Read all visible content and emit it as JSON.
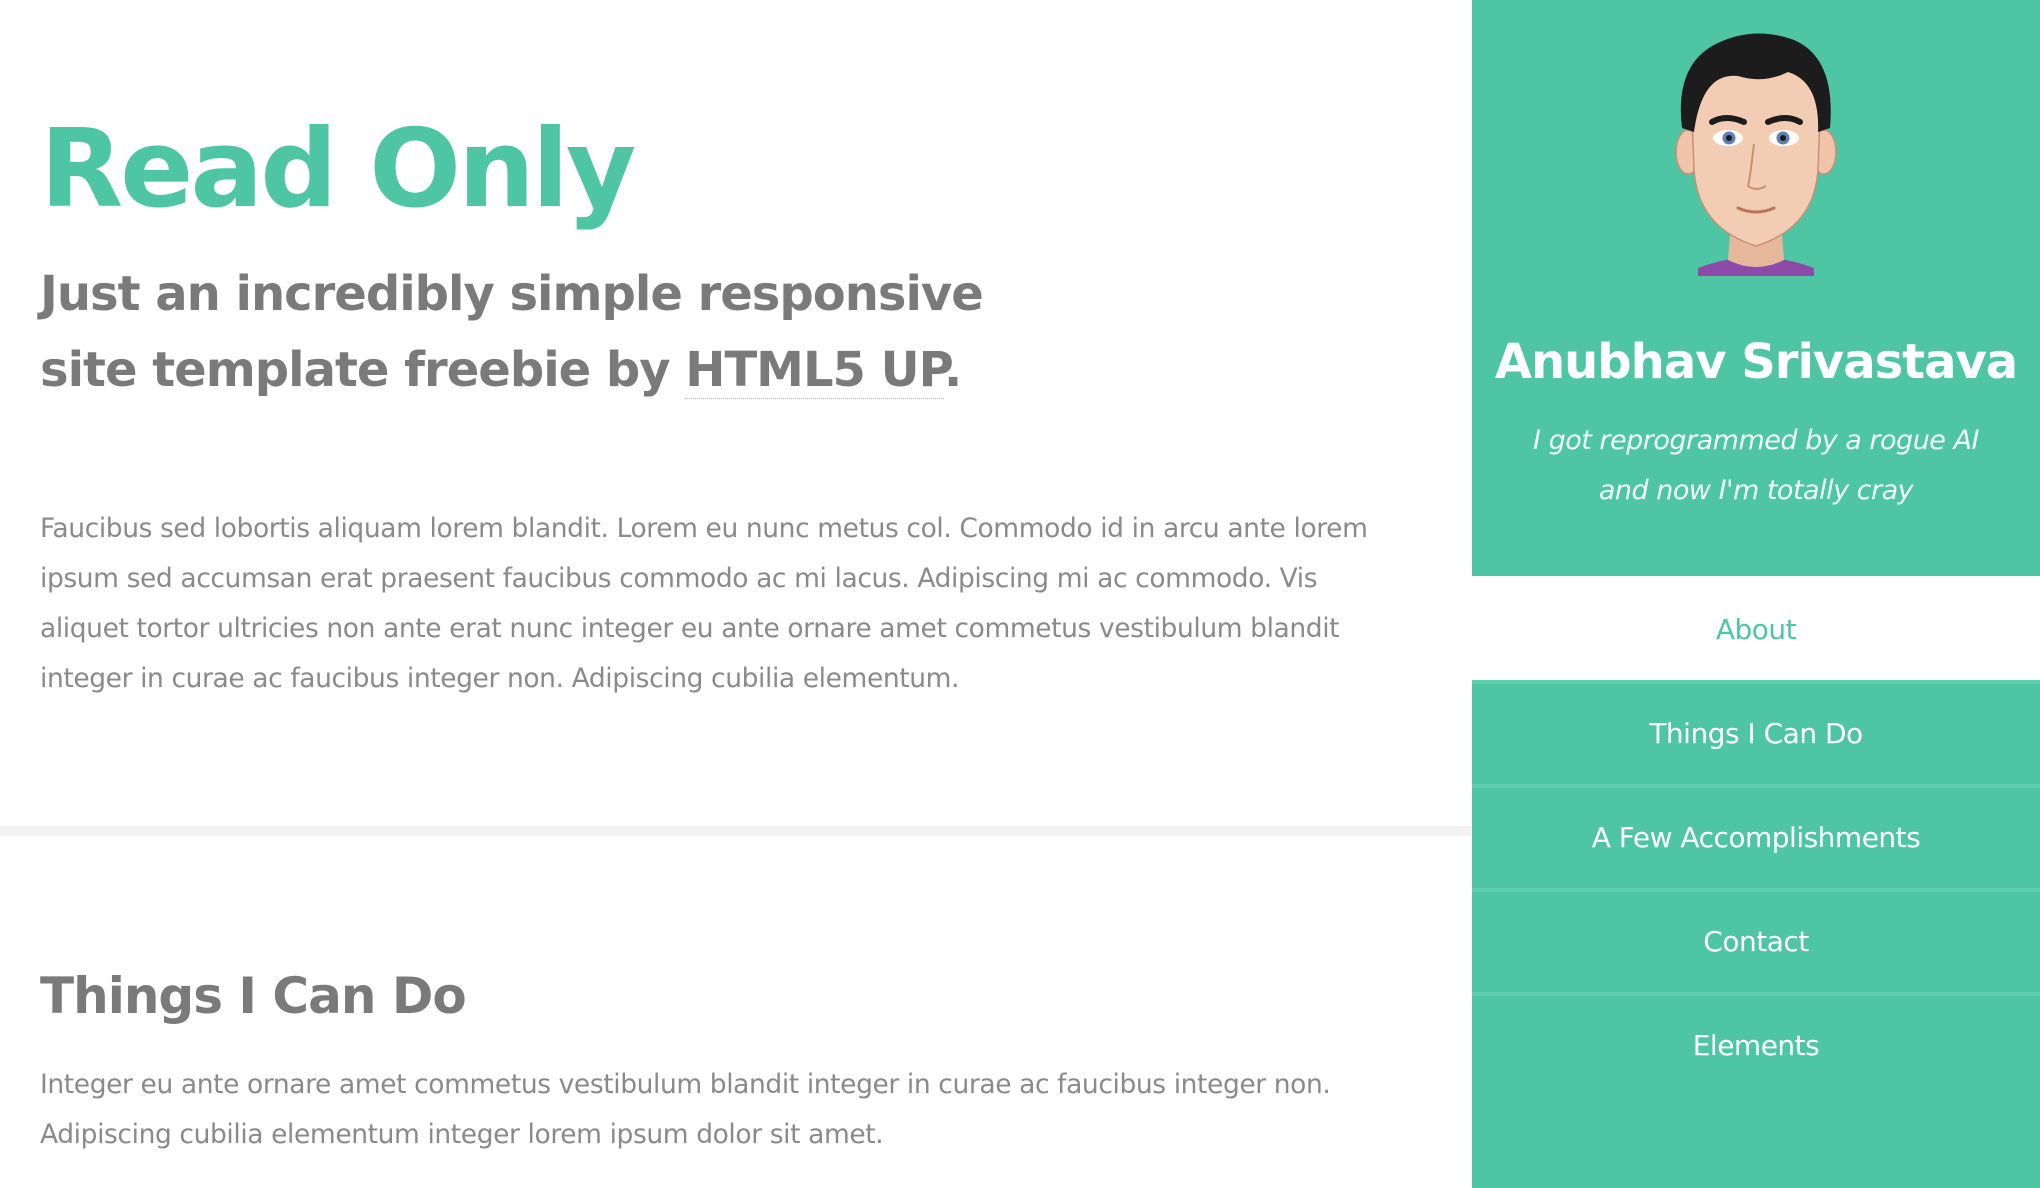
{
  "colors": {
    "accent": "#4ec6a4",
    "heading_gray": "#7a7a7a",
    "body_gray": "#8a8a8a",
    "divider": "#f3f3f3"
  },
  "header": {
    "title": "Read Only",
    "tagline_prefix": "Just an incredibly simple responsive site template freebie by ",
    "tagline_link": "HTML5 UP",
    "tagline_suffix": "."
  },
  "intro": {
    "text": "Faucibus sed lobortis aliquam lorem blandit. Lorem eu nunc metus col. Commodo id in arcu ante lorem ipsum sed accumsan erat praesent faucibus commodo ac mi lacus. Adipiscing mi ac commodo. Vis aliquet tortor ultricies non ante erat nunc integer eu ante ornare amet commetus vestibulum blandit integer in curae ac faucibus integer non. Adipiscing cubilia elementum."
  },
  "section_one": {
    "title": "Things I Can Do",
    "text": "Integer eu ante ornare amet commetus vestibulum blandit integer in curae ac faucibus integer non. Adipiscing cubilia elementum integer lorem ipsum dolor sit amet."
  },
  "sidebar": {
    "avatar_icon": "cartoon-avatar",
    "name": "Anubhav Srivastava",
    "bio": "I got reprogrammed by a rogue AI and now I'm totally cray",
    "nav": [
      {
        "label": "About",
        "active": true
      },
      {
        "label": "Things I Can Do",
        "active": false
      },
      {
        "label": "A Few Accomplishments",
        "active": false
      },
      {
        "label": "Contact",
        "active": false
      },
      {
        "label": "Elements",
        "active": false
      }
    ]
  }
}
